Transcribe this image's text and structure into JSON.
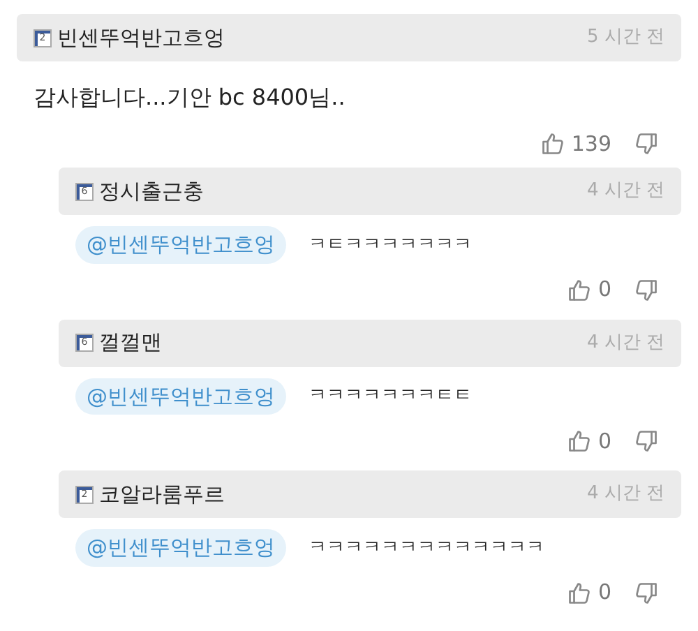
{
  "comment": {
    "level": "2",
    "author": "빈센뚜억반고흐엉",
    "time": "5 시간 전",
    "text": "감사합니다...기안 bc 8400님..",
    "likes": "139"
  },
  "replies": [
    {
      "level": "6",
      "author": "정시출근충",
      "time": "4 시간 전",
      "mention": "@빈센뚜억반고흐엉",
      "text": "ㅋㅌㅋㅋㅋㅋㅋㅋㅋ",
      "likes": "0"
    },
    {
      "level": "6",
      "author": "껄껄맨",
      "time": "4 시간 전",
      "mention": "@빈센뚜억반고흐엉",
      "text": "ㅋㅋㅋㅋㅋㅋㅋㅌㅌ",
      "likes": "0"
    },
    {
      "level": "2",
      "author": "코알라룸푸르",
      "time": "4 시간 전",
      "mention": "@빈센뚜억반고흐엉",
      "text": "ㅋㅋㅋㅋㅋㅋㅋㅋㅋㅋㅋㅋㅋ",
      "likes": "0"
    }
  ]
}
